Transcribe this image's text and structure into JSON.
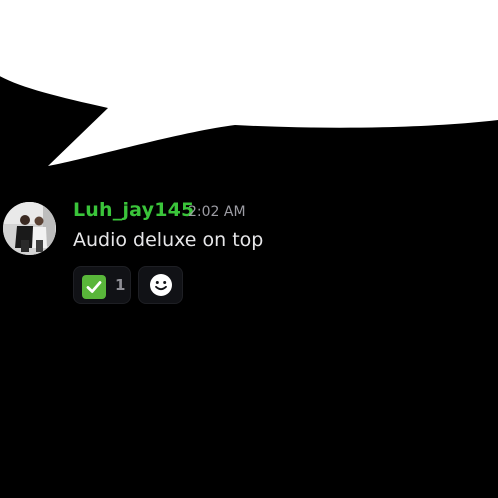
{
  "message": {
    "author": "Luh_jay145",
    "timestamp": "2:02 AM",
    "text": "Audio deluxe on top",
    "author_color": "#3ac43a"
  },
  "reactions": [
    {
      "emoji": "white-check-mark-icon",
      "count": "1"
    }
  ],
  "add_reaction": {
    "icon": "smile-icon"
  },
  "colors": {
    "background": "#000000",
    "bubble": "#ffffff",
    "text": "#e6e6e8",
    "timestamp": "#9c9ca3"
  }
}
